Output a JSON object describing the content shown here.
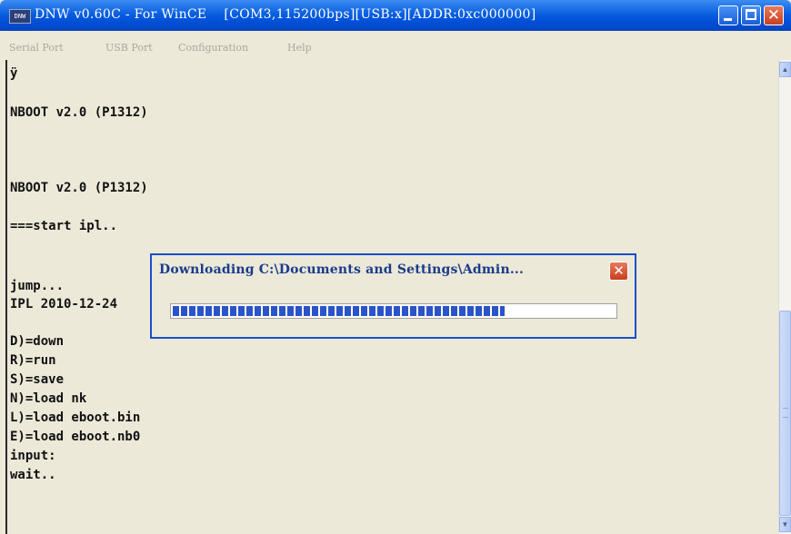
{
  "window": {
    "app_icon_label": "DNW",
    "title": "DNW v0.60C - For WinCE    [COM3,115200bps][USB:x][ADDR:0xc000000]"
  },
  "menu": {
    "items": [
      "Serial Port",
      "USB Port",
      "Configuration",
      "Help"
    ]
  },
  "terminal": {
    "lines": [
      "ÿ",
      "NBOOT v2.0 (P1312)",
      "NBOOT v2.0 (P1312)",
      "===start ipl..",
      "jump...",
      "IPL 2010-12-24",
      "D)=down",
      "R)=run",
      "S)=save",
      "N)=load nk",
      "L)=load eboot.bin",
      "E)=load eboot.nb0",
      "input:",
      "wait.."
    ]
  },
  "download_dialog": {
    "title": "Downloading C:\\Documents and Settings\\Admin...",
    "progress_fraction": 0.75
  },
  "colors": {
    "titlebar_blue": "#0a5fe0",
    "close_red": "#c8401e",
    "progress_blue": "#2a55c8",
    "window_bg": "#ece9d8"
  }
}
